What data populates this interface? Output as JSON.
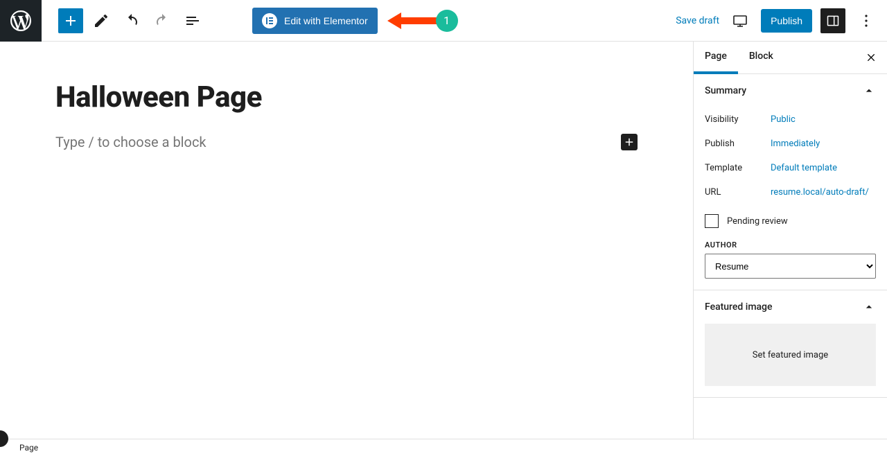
{
  "toolbar": {
    "elementor_label": "Edit with Elementor",
    "save_draft": "Save draft",
    "publish": "Publish"
  },
  "annotation": {
    "badge": "1"
  },
  "editor": {
    "title": "Halloween Page",
    "block_prompt": "Type / to choose a block"
  },
  "sidebar": {
    "tabs": {
      "page": "Page",
      "block": "Block"
    },
    "summary": {
      "heading": "Summary",
      "rows": {
        "visibility_label": "Visibility",
        "visibility_value": "Public",
        "publish_label": "Publish",
        "publish_value": "Immediately",
        "template_label": "Template",
        "template_value": "Default template",
        "url_label": "URL",
        "url_value": "resume.local/auto-draft/"
      },
      "pending_review": "Pending review",
      "author_label": "AUTHOR",
      "author_value": "Resume"
    },
    "featured": {
      "heading": "Featured image",
      "placeholder": "Set featured image"
    }
  },
  "footer": {
    "breadcrumb": "Page"
  }
}
